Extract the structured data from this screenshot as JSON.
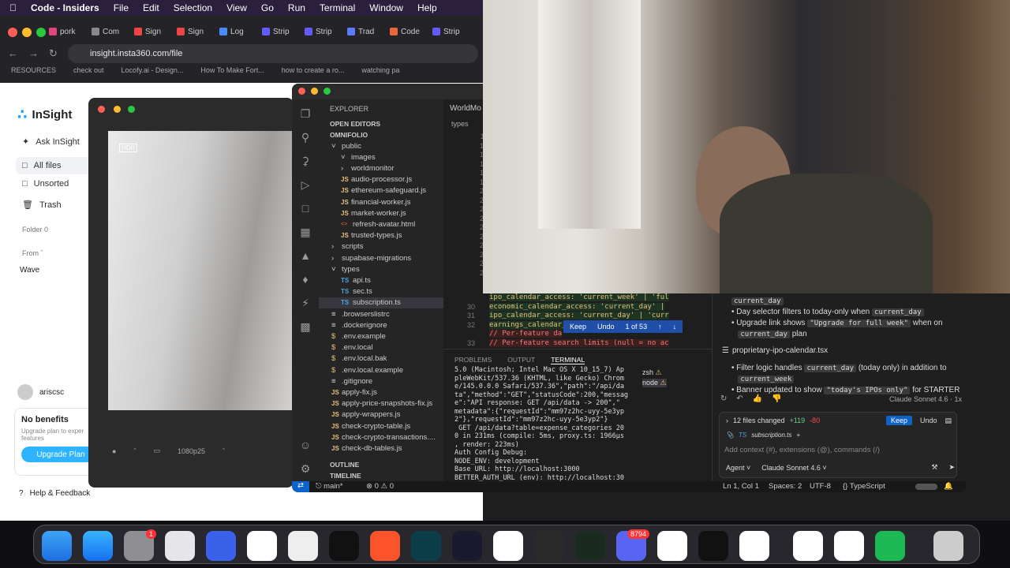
{
  "menubar": {
    "app": "Code - Insiders",
    "items": [
      "File",
      "Edit",
      "Selection",
      "View",
      "Go",
      "Run",
      "Terminal",
      "Window",
      "Help"
    ]
  },
  "browser": {
    "tabs": [
      "pork",
      "Com",
      "Sign",
      "Sign",
      "Log",
      "Strip",
      "Strip",
      "Trad",
      "Code",
      "Strip"
    ],
    "url": "insight.insta360.com/file",
    "bookmarks": [
      "RESOURCES",
      "check out",
      "Locofy.ai - Design...",
      "How To Make Fort...",
      "how to create a ro...",
      "watching pa"
    ]
  },
  "insight": {
    "logo": "InSight",
    "nav": [
      "Ask InSight",
      "All files",
      "Unsorted",
      "Trash"
    ],
    "folder_label": "Folder 0",
    "from_label": "From",
    "wave": "Wave",
    "user": "ariscsc",
    "benefits_title": "No benefits",
    "benefits_text": "Upgrade plan to exper features",
    "upgrade_btn": "Upgrade Plan",
    "help": "Help & Feedback"
  },
  "video": {
    "hdr": "HDR",
    "quality": "1080p25"
  },
  "vscode": {
    "explorer_title": "EXPLORER",
    "open_editors": "OPEN EDITORS",
    "project": "OMNIFOLIO",
    "tree": [
      {
        "label": "public",
        "kind": "folder",
        "depth": 1,
        "open": true
      },
      {
        "label": "images",
        "kind": "folder",
        "depth": 2,
        "open": true
      },
      {
        "label": "worldmonitor",
        "kind": "folder",
        "depth": 2,
        "open": false
      },
      {
        "label": "audio-processor.js",
        "kind": "js",
        "depth": 2
      },
      {
        "label": "ethereum-safeguard.js",
        "kind": "js",
        "depth": 2
      },
      {
        "label": "financial-worker.js",
        "kind": "js",
        "depth": 2
      },
      {
        "label": "market-worker.js",
        "kind": "js",
        "depth": 2
      },
      {
        "label": "refresh-avatar.html",
        "kind": "html",
        "depth": 2
      },
      {
        "label": "trusted-types.js",
        "kind": "js",
        "depth": 2
      },
      {
        "label": "scripts",
        "kind": "folder",
        "depth": 1,
        "open": false
      },
      {
        "label": "supabase-migrations",
        "kind": "folder",
        "depth": 1,
        "open": false
      },
      {
        "label": "types",
        "kind": "folder",
        "depth": 1,
        "open": true
      },
      {
        "label": "api.ts",
        "kind": "ts",
        "depth": 2
      },
      {
        "label": "sec.ts",
        "kind": "ts",
        "depth": 2
      },
      {
        "label": "subscription.ts",
        "kind": "ts",
        "depth": 2
      },
      {
        "label": ".browserslistrc",
        "kind": "file",
        "depth": 1
      },
      {
        "label": ".dockerignore",
        "kind": "file",
        "depth": 1
      },
      {
        "label": ".env.example",
        "kind": "env",
        "depth": 1
      },
      {
        "label": ".env.local",
        "kind": "env",
        "depth": 1
      },
      {
        "label": ".env.local.bak",
        "kind": "env",
        "depth": 1
      },
      {
        "label": ".env.local.example",
        "kind": "env",
        "depth": 1
      },
      {
        "label": ".gitignore",
        "kind": "file",
        "depth": 1
      },
      {
        "label": "apply-fix.js",
        "kind": "js",
        "depth": 1
      },
      {
        "label": "apply-price-snapshots-fix.js",
        "kind": "js",
        "depth": 1
      },
      {
        "label": "apply-wrappers.js",
        "kind": "js",
        "depth": 1
      },
      {
        "label": "check-crypto-table.js",
        "kind": "js",
        "depth": 1
      },
      {
        "label": "check-crypto-transactions....",
        "kind": "js",
        "depth": 1
      },
      {
        "label": "check-db-tables.js",
        "kind": "js",
        "depth": 1
      }
    ],
    "outline": "OUTLINE",
    "timeline": "TIMELINE",
    "editor_tab": "WorldMo",
    "breadcrumb": "types",
    "line_numbers": [
      "11",
      "15",
      "16",
      "17",
      "18",
      "19",
      "20",
      "21",
      "22",
      "23",
      "24",
      "25",
      "26",
      "27",
      "28",
      "29"
    ],
    "code_lines": [
      {
        "n": "",
        "text": "ipo_calendar_access: 'current_week' | 'ful"
      },
      {
        "n": "30",
        "text": "economic_calendar_access: 'current_day' |"
      },
      {
        "n": "31",
        "text": "ipo_calendar_access: 'current_day' | 'curr"
      },
      {
        "n": "32",
        "text": "earnings_calendar_"
      },
      {
        "n": "",
        "text": "// Per-feature da"
      },
      {
        "n": "33",
        "text": "// Per-feature search limits (null = no ac"
      }
    ],
    "diff_toolbar": {
      "keep": "Keep",
      "undo": "Undo",
      "count": "1 of 53"
    },
    "panel_tabs": [
      "PROBLEMS",
      "OUTPUT",
      "TERMINAL"
    ],
    "terminal": "5.0 (Macintosh; Intel Mac OS X 10_15_7) Ap\npleWebKit/537.36 (KHTML, like Gecko) Chrom\ne/145.0.0.0 Safari/537.36\",\"path\":\"/api/da\nta\",\"method\":\"GET\",\"statusCode\":200,\"messag\ne\":\"API response: GET /api/data -> 200\",\"\nmetadata\":{\"requestId\":\"mm97z2hc-uyy-5e3yp\n2\"},\"requestId\":\"mm97z2hc-uyy-5e3yp2\"}\n GET /api/data?table=expense_categories 20\n0 in 231ms (compile: 5ms, proxy.ts: 1966µs\n, render: 223ms)\nAuth Config Debug:\nNODE_ENV: development\nBase URL: http://localhost:3000\nBETTER_AUTH_URL (env): http://localhost:30\n00",
    "shells": [
      "zsh",
      "node"
    ],
    "chat": {
      "chip_top": "current_day",
      "bullets1": [
        [
          "Day selector filters to today-only when ",
          "current_day",
          ""
        ],
        [
          "Upgrade link shows ",
          "\"Upgrade for full week\"",
          " when on"
        ],
        [
          "",
          "current_day",
          " plan"
        ]
      ],
      "file": "proprietary-ipo-calendar.tsx",
      "bullets2": [
        [
          "Filter logic handles ",
          "current_day",
          " (today only) in addition to"
        ],
        [
          "",
          "current_week",
          ""
        ],
        [
          "Banner updated to show ",
          "\"today's IPOs only\"",
          " for STARTER"
        ]
      ],
      "model_note": "Claude Sonnet 4.6 · 1x",
      "changed": "12 files changed",
      "added": "+119",
      "removed": "-80",
      "keep": "Keep",
      "undo": "Undo",
      "context_file": "subscription.ts",
      "placeholder": "Add context (#), extensions (@), commands (/)",
      "mode": "Agent",
      "model": "Claude Sonnet 4.6"
    },
    "status": {
      "branch": "main*",
      "errors": "0",
      "warnings": "0",
      "position": "Ln 1, Col 1",
      "spaces": "Spaces: 2",
      "encoding": "UTF-8",
      "language": "TypeScript"
    }
  },
  "dock": {
    "badges": {
      "settings": "1",
      "discord": "8794"
    }
  }
}
